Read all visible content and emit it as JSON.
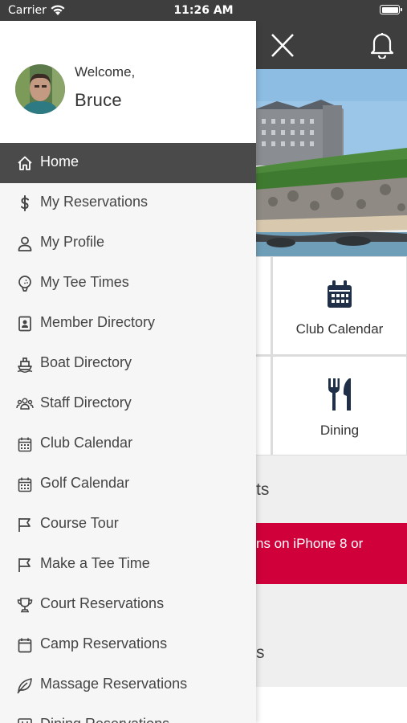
{
  "status_bar": {
    "carrier": "Carrier",
    "time": "11:26 AM"
  },
  "drawer": {
    "welcome": "Welcome,",
    "user_name": "Bruce",
    "items": [
      {
        "label": "Home",
        "icon": "home-icon",
        "active": true
      },
      {
        "label": "My Reservations",
        "icon": "dollar-icon"
      },
      {
        "label": "My Profile",
        "icon": "user-icon"
      },
      {
        "label": "My Tee Times",
        "icon": "golf-ball-icon"
      },
      {
        "label": "Member Directory",
        "icon": "contact-card-icon"
      },
      {
        "label": "Boat Directory",
        "icon": "boat-icon"
      },
      {
        "label": "Staff Directory",
        "icon": "users-icon"
      },
      {
        "label": "Club Calendar",
        "icon": "calendar-icon"
      },
      {
        "label": "Golf Calendar",
        "icon": "calendar-icon"
      },
      {
        "label": "Course Tour",
        "icon": "flag-icon"
      },
      {
        "label": "Make a Tee Time",
        "icon": "flag-icon"
      },
      {
        "label": "Court Reservations",
        "icon": "trophy-icon"
      },
      {
        "label": "Camp Reservations",
        "icon": "calendar-blank-icon"
      },
      {
        "label": "Massage Reservations",
        "icon": "leaf-icon"
      },
      {
        "label": "Dining Reservations",
        "icon": "dining-icon"
      }
    ]
  },
  "main": {
    "tiles": [
      {
        "label": "Club Calendar",
        "icon": "calendar-icon"
      },
      {
        "label": "Dining",
        "icon": "fork-knife-icon"
      }
    ],
    "section_1_visible": "ts",
    "alert_visible": "ns on iPhone 8 or",
    "section_2_visible": "s"
  },
  "colors": {
    "header": "#3e3e3e",
    "active_item": "#4a4a4a",
    "alert": "#d0003a",
    "icon_navy": "#1f2f47"
  }
}
